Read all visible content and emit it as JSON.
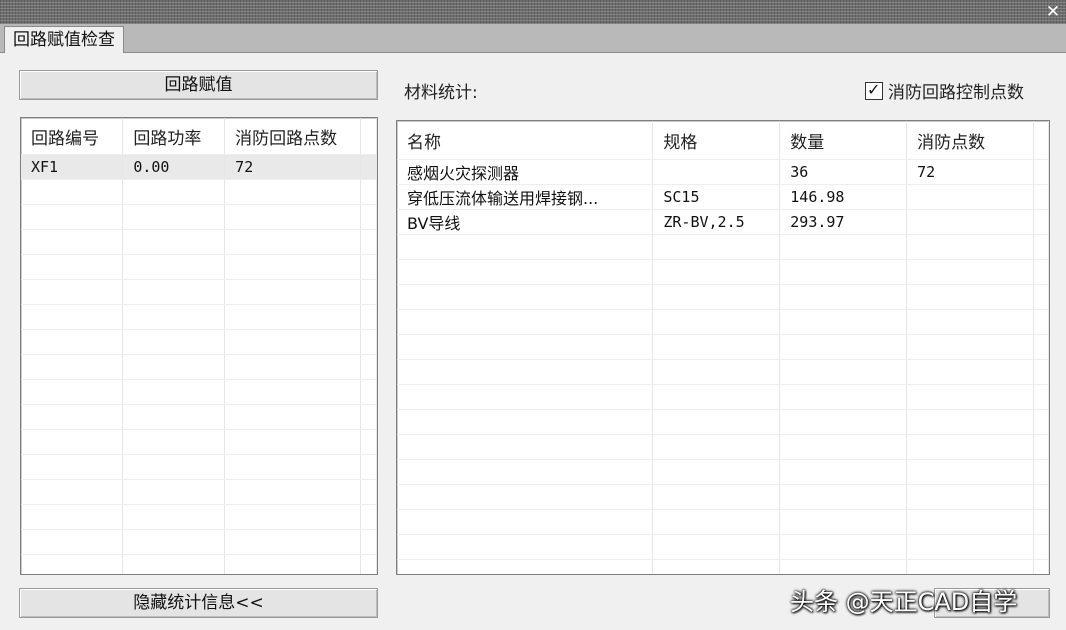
{
  "window": {
    "close_glyph": "✕",
    "tab_title": "回路赋值检查"
  },
  "left": {
    "assign_button": "回路赋值",
    "columns": [
      "回路编号",
      "回路功率",
      "消防回路点数"
    ],
    "rows": [
      [
        "XF1",
        "0.00",
        "72"
      ]
    ],
    "hide_button": "隐藏统计信息<<"
  },
  "right": {
    "stats_label": "材料统计:",
    "fire_checkbox": {
      "label": "消防回路控制点数",
      "checked": true
    },
    "columns": [
      "名称",
      "规格",
      "数量",
      "消防点数"
    ],
    "rows": [
      [
        "感烟火灾探测器",
        "",
        "36",
        "72"
      ],
      [
        "穿低压流体输送用焊接钢...",
        "SC15",
        "146.98",
        ""
      ],
      [
        "BV导线",
        "ZR-BV,2.5",
        "293.97",
        ""
      ]
    ]
  },
  "watermark": "头条 @天正CAD自学",
  "icons": {
    "checkbox_tick": "check-icon",
    "close": "close-icon"
  }
}
